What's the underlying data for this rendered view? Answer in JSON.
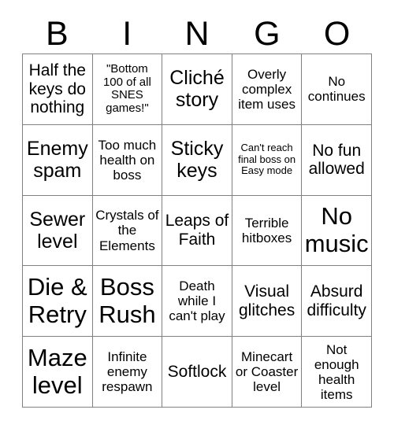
{
  "card": {
    "header_letters": [
      "B",
      "I",
      "N",
      "G",
      "O"
    ],
    "columns": 5,
    "rows": 5,
    "background_color": "#ffffff",
    "border_color": "#808080",
    "text_color": "#000000",
    "cells": [
      {
        "text": "Half the keys do nothing",
        "size": "lg"
      },
      {
        "text": "\"Bottom 100 of all SNES games!\"",
        "size": "sm"
      },
      {
        "text": "Cliché story",
        "size": "xl"
      },
      {
        "text": "Overly complex item uses",
        "size": "md"
      },
      {
        "text": "No continues",
        "size": "md"
      },
      {
        "text": "Enemy spam",
        "size": "xl"
      },
      {
        "text": "Too much health on boss",
        "size": "md"
      },
      {
        "text": "Sticky keys",
        "size": "xl"
      },
      {
        "text": "Can't reach final boss on Easy mode",
        "size": "xs"
      },
      {
        "text": "No fun allowed",
        "size": "lg"
      },
      {
        "text": "Sewer level",
        "size": "xl"
      },
      {
        "text": "Crystals of the Elements",
        "size": "md"
      },
      {
        "text": "Leaps of Faith",
        "size": "lg"
      },
      {
        "text": "Terrible hitboxes",
        "size": "md"
      },
      {
        "text": "No music",
        "size": "xxl"
      },
      {
        "text": "Die & Retry",
        "size": "xxl"
      },
      {
        "text": "Boss Rush",
        "size": "xxl"
      },
      {
        "text": "Death while I can't play",
        "size": "md"
      },
      {
        "text": "Visual glitches",
        "size": "lg"
      },
      {
        "text": "Absurd difficulty",
        "size": "lg"
      },
      {
        "text": "Maze level",
        "size": "xxl"
      },
      {
        "text": "Infinite enemy respawn",
        "size": "md"
      },
      {
        "text": "Softlock",
        "size": "lg"
      },
      {
        "text": "Minecart or Coaster level",
        "size": "md"
      },
      {
        "text": "Not enough health items",
        "size": "md"
      }
    ]
  }
}
